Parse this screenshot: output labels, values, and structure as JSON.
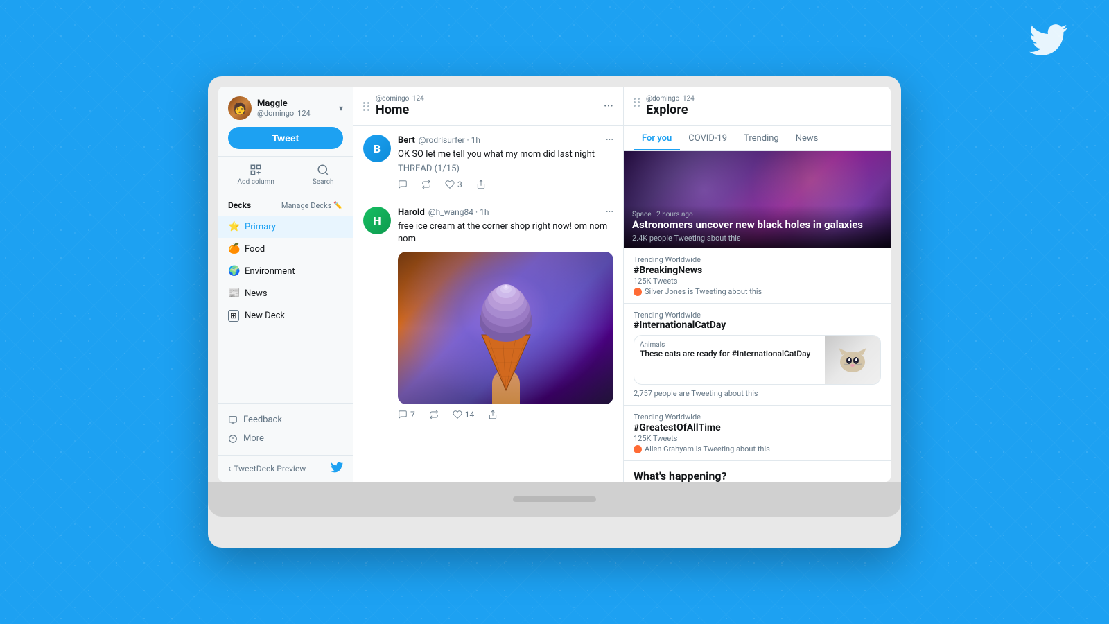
{
  "background": {
    "color": "#1DA1F2"
  },
  "twitter_bird": "🐦",
  "laptop": {
    "sidebar": {
      "user": {
        "name": "Maggie",
        "handle": "@domingo_124"
      },
      "tweet_button": "Tweet",
      "add_column": "Add column",
      "search": "Search",
      "decks_label": "Decks",
      "manage_decks": "Manage Decks",
      "deck_items": [
        {
          "icon": "⭐",
          "label": "Primary",
          "active": true
        },
        {
          "icon": "🍊",
          "label": "Food",
          "active": false
        },
        {
          "icon": "🌍",
          "label": "Environment",
          "active": false
        },
        {
          "icon": "📰",
          "label": "News",
          "active": false
        },
        {
          "icon": "➕",
          "label": "New Deck",
          "active": false
        }
      ],
      "footer": {
        "feedback": "Feedback",
        "more": "More"
      },
      "preview_label": "TweetDeck Preview",
      "back_arrow": "‹"
    },
    "home_column": {
      "source": "@domingo_124",
      "title": "Home",
      "tweets": [
        {
          "name": "Bert",
          "handle": "@rodrisurfer",
          "time": "1h",
          "text": "OK SO let me tell you what my mom did last night",
          "thread": "THREAD (1/15)",
          "replies": "",
          "retweets": "",
          "likes": "3",
          "has_image": false
        },
        {
          "name": "Harold",
          "handle": "@h_wang84",
          "time": "1h",
          "text": "free ice cream at the corner shop right now! om nom nom",
          "thread": "",
          "replies": "7",
          "retweets": "",
          "likes": "14",
          "has_image": true
        }
      ]
    },
    "explore_column": {
      "source": "@domingo_124",
      "title": "Explore",
      "tabs": [
        "For you",
        "COVID-19",
        "Trending",
        "News"
      ],
      "active_tab": "For you",
      "hero": {
        "category": "Space · 2 hours ago",
        "title": "Astronomers uncover new black holes in galaxies",
        "count": "2.4K people Tweeting about this"
      },
      "trending": [
        {
          "label": "Trending Worldwide",
          "tag": "#BreakingNews",
          "count": "125K Tweets",
          "attribution": "Silver Jones is Tweeting about this",
          "dot_color": "#ff6b35"
        },
        {
          "label": "Trending Worldwide",
          "tag": "#InternationalCatDay",
          "count": "",
          "card": {
            "category": "Animals",
            "title": "These cats are ready for #InternationalCatDay",
            "count": "2,757 people are Tweeting about this"
          }
        },
        {
          "label": "Trending Worldwide",
          "tag": "#GreatestOfAllTime",
          "count": "125K Tweets",
          "attribution": "Allen Grahyam is Tweeting about this",
          "dot_color": "#ff6b35"
        }
      ],
      "whats_happening": "What's happening?"
    }
  }
}
